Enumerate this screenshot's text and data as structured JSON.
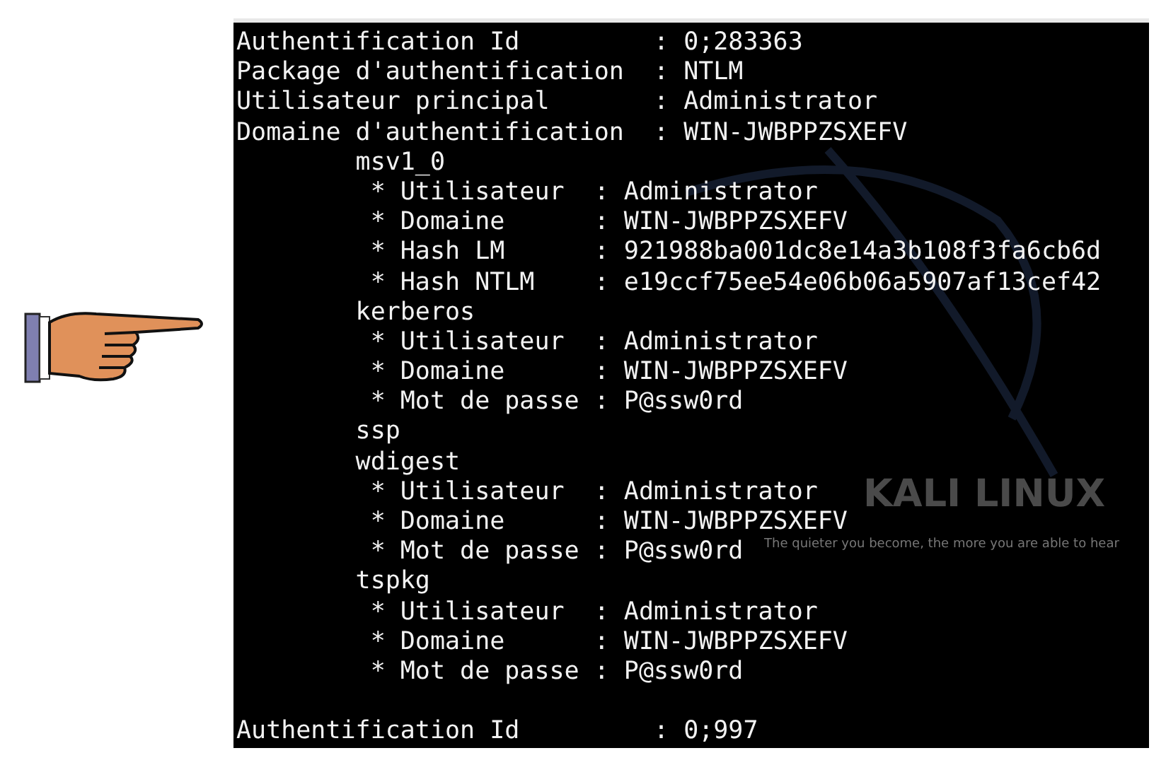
{
  "wallpaper": {
    "logo": "KALI LINUX",
    "tagline": "The quieter you become, the more you are able to hear"
  },
  "terminal": {
    "lines": [
      {
        "kind": "text",
        "text": "Authentification Id         : 0;283363"
      },
      {
        "kind": "text",
        "text": "Package d'authentification  : NTLM"
      },
      {
        "kind": "text",
        "text": "Utilisateur principal       : Administrator"
      },
      {
        "kind": "text",
        "text": "Domaine d'authentification  : WIN-JWBPPZSXEFV"
      },
      {
        "kind": "text",
        "text": "        msv1_0"
      },
      {
        "kind": "text",
        "text": "         * Utilisateur  : Administrator"
      },
      {
        "kind": "text",
        "text": "         * Domaine      : WIN-JWBPPZSXEFV"
      },
      {
        "kind": "text",
        "text": "         * Hash LM      : 921988ba001dc8e14a3b108f3fa6cb6d"
      },
      {
        "kind": "text",
        "text": "         * Hash NTLM    : e19ccf75ee54e06b06a5907af13cef42"
      },
      {
        "kind": "text",
        "text": "        kerberos"
      },
      {
        "kind": "text",
        "text": "         * Utilisateur  : Administrator"
      },
      {
        "kind": "text",
        "text": "         * Domaine      : WIN-JWBPPZSXEFV"
      },
      {
        "kind": "text",
        "text": "         * Mot de passe : P@ssw0rd"
      },
      {
        "kind": "text",
        "text": "        ssp"
      },
      {
        "kind": "text",
        "text": "        wdigest"
      },
      {
        "kind": "text",
        "text": "         * Utilisateur  : Administrator"
      },
      {
        "kind": "text",
        "text": "         * Domaine      : WIN-JWBPPZSXEFV"
      },
      {
        "kind": "text",
        "text": "         * Mot de passe : P@ssw0rd"
      },
      {
        "kind": "text",
        "text": "        tspkg"
      },
      {
        "kind": "text",
        "text": "         * Utilisateur  : Administrator"
      },
      {
        "kind": "text",
        "text": "         * Domaine      : WIN-JWBPPZSXEFV"
      },
      {
        "kind": "text",
        "text": "         * Mot de passe : P@ssw0rd"
      },
      {
        "kind": "blank"
      },
      {
        "kind": "text",
        "text": "Authentification Id         : 0;997"
      }
    ]
  }
}
